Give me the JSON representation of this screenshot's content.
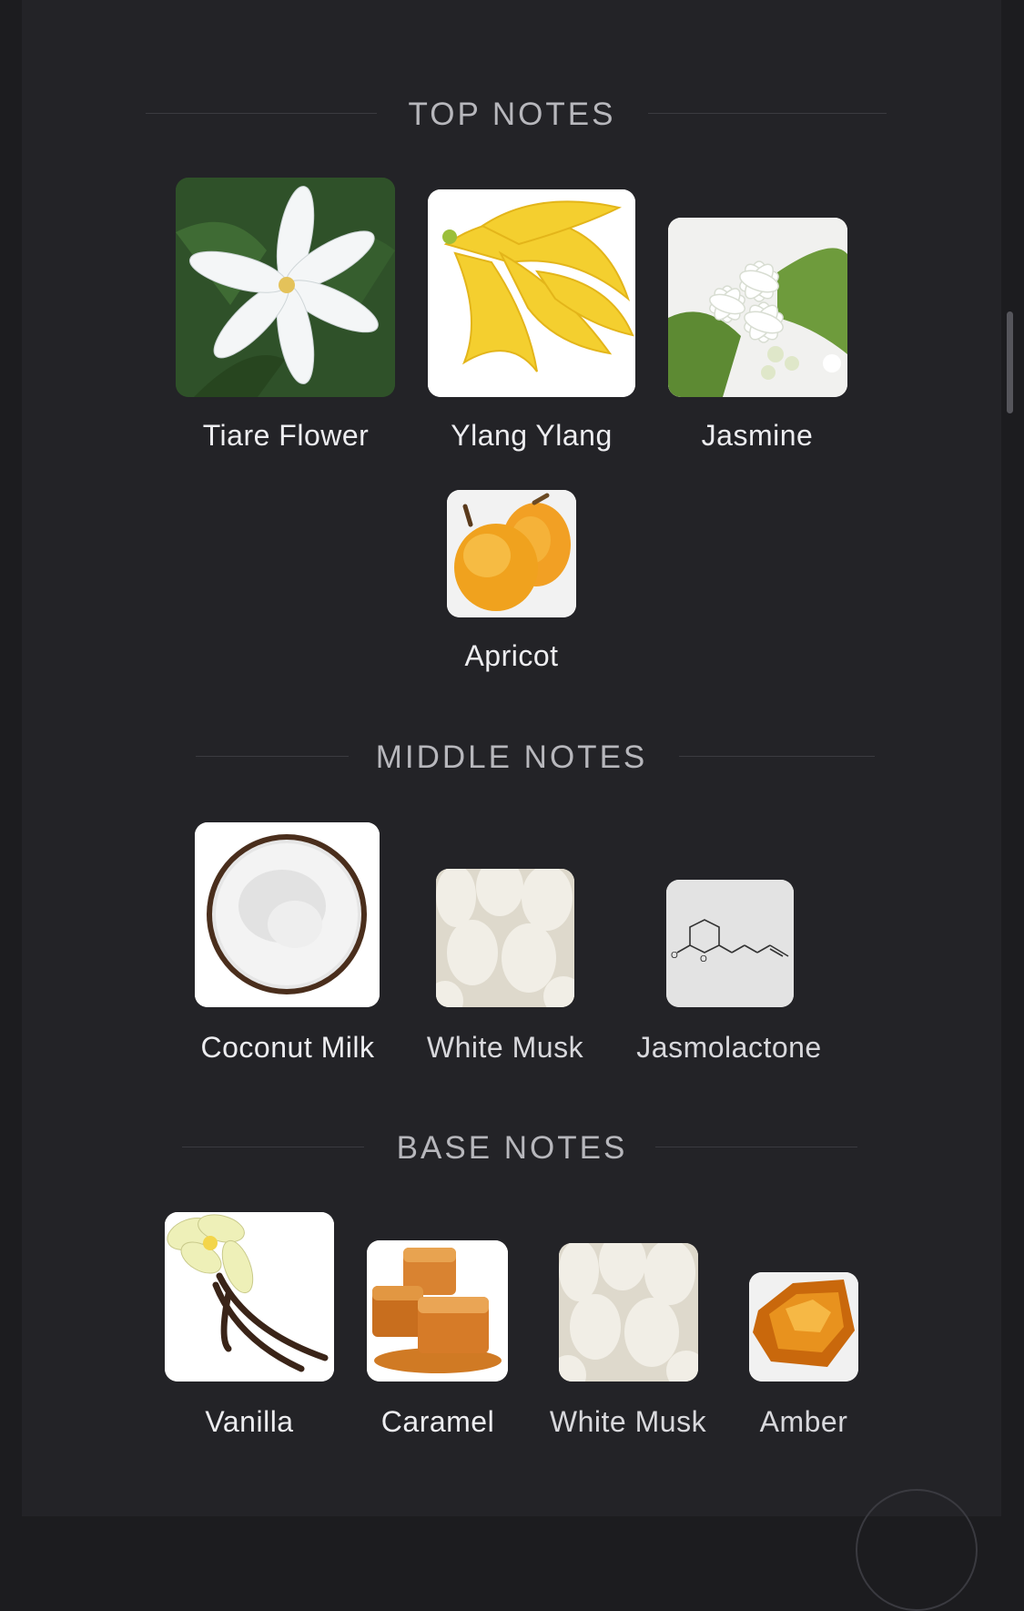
{
  "sections": {
    "top": {
      "title": "TOP NOTES",
      "notes": [
        {
          "label": "Tiare Flower",
          "icon": "tiare-flower-image"
        },
        {
          "label": "Ylang Ylang",
          "icon": "ylang-ylang-image"
        },
        {
          "label": "Jasmine",
          "icon": "jasmine-image"
        },
        {
          "label": "Apricot",
          "icon": "apricot-image"
        }
      ]
    },
    "middle": {
      "title": "MIDDLE NOTES",
      "notes": [
        {
          "label": "Coconut Milk",
          "icon": "coconut-image"
        },
        {
          "label": "White Musk",
          "icon": "white-musk-image"
        },
        {
          "label": "Jasmolactone",
          "icon": "jasmolactone-molecule-image"
        }
      ]
    },
    "base": {
      "title": "BASE NOTES",
      "notes": [
        {
          "label": "Vanilla",
          "icon": "vanilla-image"
        },
        {
          "label": "Caramel",
          "icon": "caramel-image"
        },
        {
          "label": "White Musk",
          "icon": "white-musk-image"
        },
        {
          "label": "Amber",
          "icon": "amber-image"
        }
      ]
    }
  },
  "colors": {
    "background": "#232327",
    "heading": "#b7b7bc",
    "label": "#ededf0"
  }
}
